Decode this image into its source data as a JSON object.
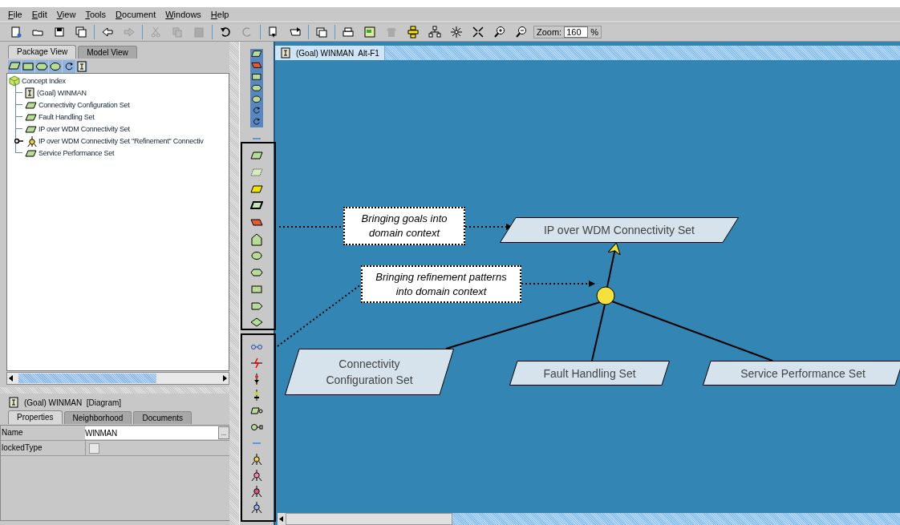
{
  "menu": [
    {
      "label": "File"
    },
    {
      "label": "Edit"
    },
    {
      "label": "View"
    },
    {
      "label": "Tools"
    },
    {
      "label": "Document"
    },
    {
      "label": "Windows"
    },
    {
      "label": "Help"
    }
  ],
  "toolbar": {
    "zoom_label": "Zoom:",
    "zoom_value": "160",
    "zoom_unit": "%"
  },
  "left_panel": {
    "tabs": [
      {
        "label": "Package View",
        "selected": true
      },
      {
        "label": "Model View",
        "selected": false
      }
    ],
    "tree": {
      "label": "Concept Index",
      "kind": "package",
      "children": [
        {
          "label": "(Goal) WINMAN",
          "kind": "diagram"
        },
        {
          "label": "Connectivity Configuration Set",
          "kind": "goal"
        },
        {
          "label": "Fault Handling Set",
          "kind": "goal"
        },
        {
          "label": "IP over WDM Connectivity Set",
          "kind": "goal"
        },
        {
          "label": "IP over WDM Connectivity Set \"Refinement\" Connectiv",
          "kind": "refinement"
        },
        {
          "label": "Service Performance Set",
          "kind": "goal"
        }
      ]
    }
  },
  "inspector": {
    "title": "(Goal) WINMAN  [Diagram]",
    "tabs": [
      {
        "label": "Properties",
        "selected": true
      },
      {
        "label": "Neighborhood",
        "selected": false
      },
      {
        "label": "Documents",
        "selected": false
      }
    ],
    "rows": [
      {
        "name": "Name",
        "kind": "text",
        "value": "WINMAN",
        "button": "..."
      },
      {
        "name": "lockedType",
        "kind": "checkbox",
        "checked": false
      }
    ]
  },
  "editor": {
    "title": "(Goal) WINMAN  Alt-F1",
    "nodes": [
      {
        "label": "IP over WDM Connectivity Set",
        "kind": "goal"
      },
      {
        "label": "Connectivity Configuration Set",
        "kind": "goal"
      },
      {
        "label": "Fault Handling Set",
        "kind": "goal"
      },
      {
        "label": "Service Performance Set",
        "kind": "goal"
      }
    ],
    "callouts": [
      {
        "text": "Bringing goals into domain context"
      },
      {
        "text": "Bringing refinement patterns into domain context"
      }
    ]
  }
}
